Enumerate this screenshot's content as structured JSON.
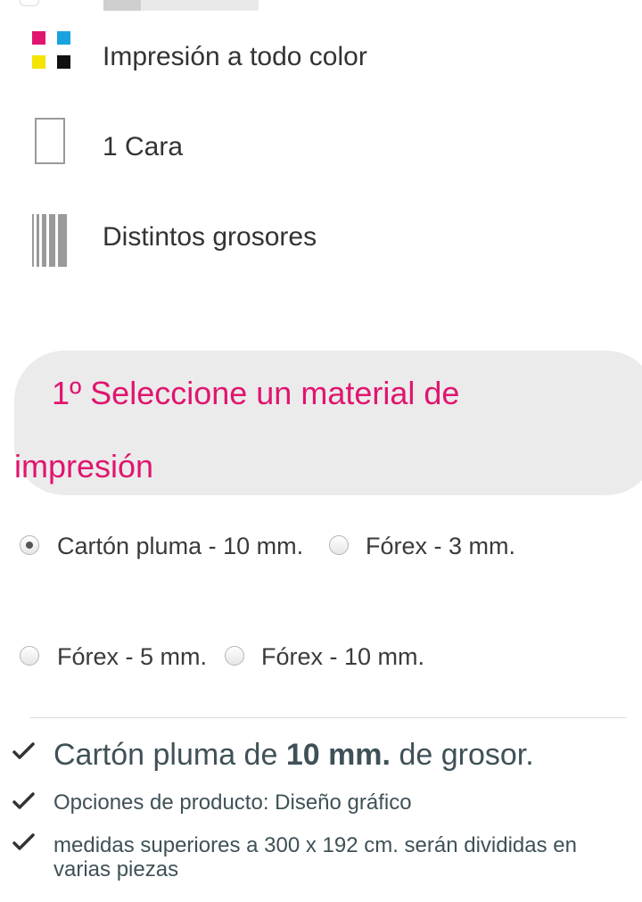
{
  "features": [
    {
      "icon": "cmyk-color-icon",
      "label": "Impresión a todo color"
    },
    {
      "icon": "single-side-icon",
      "label": "1 Cara"
    },
    {
      "icon": "thickness-icon",
      "label": "Distintos grosores"
    }
  ],
  "section": {
    "title": "1º Seleccione un material de impresión"
  },
  "materials": [
    {
      "label": "Cartón pluma - 10 mm.",
      "selected": true
    },
    {
      "label": "Fórex - 3 mm.",
      "selected": false
    },
    {
      "label": "Fórex - 5 mm.",
      "selected": false
    },
    {
      "label": "Fórex - 10 mm.",
      "selected": false
    }
  ],
  "specs": {
    "main_prefix": "Cartón pluma de ",
    "main_bold": "10 mm.",
    "main_suffix": " de grosor.",
    "options": "Opciones de producto: Diseño gráfico",
    "sizes": "medidas superiores a 300 x 192 cm. serán divididas en varias piezas"
  },
  "colors": {
    "accent": "#e0156f",
    "panel_bg": "#ebebeb",
    "spec_text": "#3f5157",
    "cmyk": [
      "#e0156f",
      "#19a3de",
      "#f5e400",
      "#111111"
    ]
  }
}
